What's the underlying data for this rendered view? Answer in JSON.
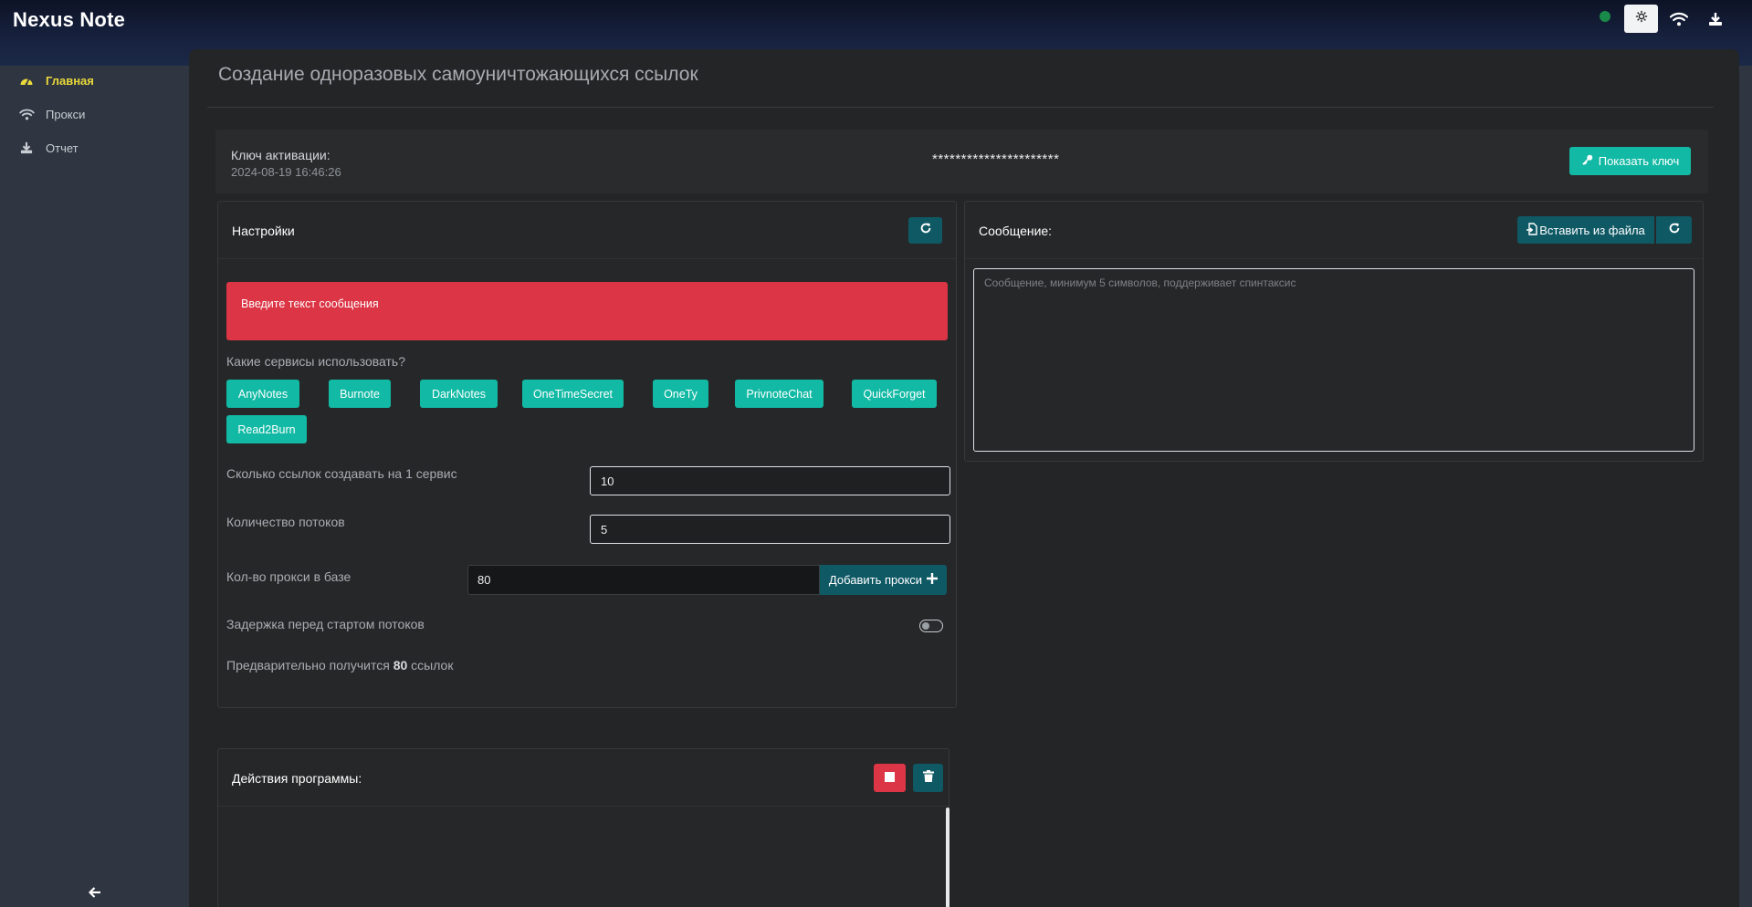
{
  "app": {
    "brand": "Nexus Note"
  },
  "header": {
    "status_color": "#1a8a4a",
    "icons": [
      "gear-icon",
      "wifi-icon",
      "download-icon"
    ]
  },
  "sidebar": {
    "items": [
      {
        "label": "Главная",
        "icon": "speedometer-icon",
        "active": true
      },
      {
        "label": "Прокси",
        "icon": "wifi-icon",
        "active": false
      },
      {
        "label": "Отчет",
        "icon": "download-icon",
        "active": false
      }
    ],
    "collapse_icon": "arrow-left-icon"
  },
  "main": {
    "title": "Создание одноразовых самоуничтожающихся ссылок",
    "activation": {
      "label": "Ключ активации:",
      "date": "2024-08-19 16:46:26",
      "masked_key": "**********************",
      "show_button": "Показать ключ"
    },
    "settings": {
      "title": "Настройки",
      "alert": "Введите текст сообщения",
      "services_question": "Какие сервисы использовать?",
      "services": [
        "AnyNotes",
        "Burnote",
        "DarkNotes",
        "OneTimeSecret",
        "OneTy",
        "PrivnoteChat",
        "QuickForget",
        "Read2Burn"
      ],
      "links_per_service_label": "Сколько ссылок создавать на 1 сервис",
      "links_per_service_value": "10",
      "threads_label": "Количество потоков",
      "threads_value": "5",
      "proxy_label": "Кол-во прокси в базе",
      "proxy_value": "80",
      "add_proxy_button": "Добавить прокси",
      "delay_label": "Задержка перед стартом потоков",
      "delay_enabled": false,
      "preview_prefix": "Предварительно получится",
      "preview_count": "80",
      "preview_suffix": "ссылок"
    },
    "message": {
      "title": "Сообщение:",
      "insert_button": "Вставить из файла",
      "placeholder": "Сообщение, минимум 5 символов, поддерживает спинтаксис"
    },
    "actions": {
      "title": "Действия программы:"
    }
  },
  "colors": {
    "accent_teal": "#12b9a4",
    "dark_teal": "#0f5965",
    "danger": "#dc3545",
    "active_nav": "#e9d93a"
  }
}
